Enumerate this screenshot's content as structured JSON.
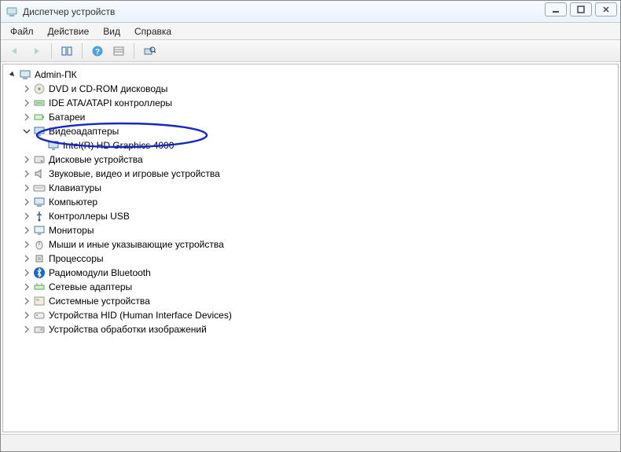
{
  "window": {
    "title": "Диспетчер устройств"
  },
  "menu": {
    "file": "Файл",
    "action": "Действие",
    "view": "Вид",
    "help": "Справка"
  },
  "tree": {
    "root": "Admin-ПК",
    "categories": [
      {
        "label": "DVD и CD-ROM дисководы",
        "icon": "disc"
      },
      {
        "label": "IDE ATA/ATAPI контроллеры",
        "icon": "ide"
      },
      {
        "label": "Батареи",
        "icon": "battery"
      },
      {
        "label": "Видеоадаптеры",
        "icon": "display",
        "expanded": true,
        "children": [
          {
            "label": "Intel(R) HD Graphics 4000",
            "icon": "display"
          }
        ]
      },
      {
        "label": "Дисковые устройства",
        "icon": "disk"
      },
      {
        "label": "Звуковые, видео и игровые устройства",
        "icon": "audio"
      },
      {
        "label": "Клавиатуры",
        "icon": "keyboard"
      },
      {
        "label": "Компьютер",
        "icon": "computer"
      },
      {
        "label": "Контроллеры USB",
        "icon": "usb"
      },
      {
        "label": "Мониторы",
        "icon": "monitor"
      },
      {
        "label": "Мыши и иные указывающие устройства",
        "icon": "mouse"
      },
      {
        "label": "Процессоры",
        "icon": "cpu"
      },
      {
        "label": "Радиомодули Bluetooth",
        "icon": "bluetooth"
      },
      {
        "label": "Сетевые адаптеры",
        "icon": "network"
      },
      {
        "label": "Системные устройства",
        "icon": "system"
      },
      {
        "label": "Устройства HID (Human Interface Devices)",
        "icon": "hid"
      },
      {
        "label": "Устройства обработки изображений",
        "icon": "imaging"
      }
    ]
  }
}
